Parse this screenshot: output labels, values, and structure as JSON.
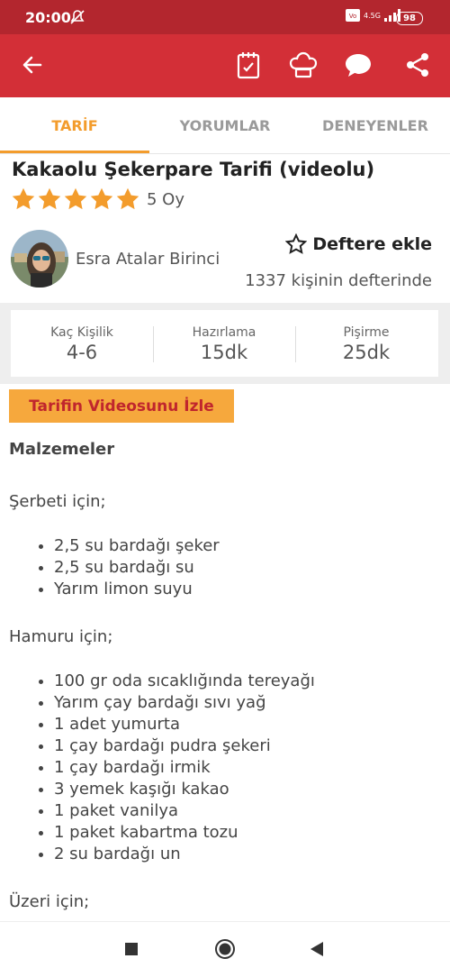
{
  "status": {
    "time": "20:00",
    "battery": "98",
    "network": "4.5G"
  },
  "tabs": [
    {
      "label": "TARİF"
    },
    {
      "label": "YORUMLAR"
    },
    {
      "label": "DENEYENLER"
    }
  ],
  "recipe": {
    "title": "Kakaolu Şekerpare Tarifi (videolu)",
    "rating": 5,
    "votes": "5 Oy",
    "author": "Esra Atalar Birinci",
    "favorite_label": "Deftere ekle",
    "favorite_count": "1337 kişinin defterinde"
  },
  "info": [
    {
      "label": "Kaç Kişilik",
      "value": "4-6"
    },
    {
      "label": "Hazırlama",
      "value": "15dk"
    },
    {
      "label": "Pişirme",
      "value": "25dk"
    }
  ],
  "video_button": "Tarifin Videosunu İzle",
  "ingredients": {
    "heading": "Malzemeler",
    "sections": [
      {
        "title": "Şerbeti için;",
        "items": [
          "2,5 su bardağı şeker",
          "2,5 su bardağı su",
          "Yarım limon suyu"
        ]
      },
      {
        "title": "Hamuru için;",
        "items": [
          "100 gr oda sıcaklığında tereyağı",
          "Yarım çay bardağı sıvı yağ",
          "1 adet yumurta",
          "1 çay bardağı pudra şekeri",
          "1 çay bardağı irmik",
          "3 yemek kaşığı kakao",
          "1 paket vanilya",
          "1 paket kabartma tozu",
          "2 su bardağı un"
        ]
      },
      {
        "title": "Üzeri için;",
        "items": []
      }
    ]
  },
  "colors": {
    "appbar": "#d32f37",
    "accent": "#f39c2c",
    "star": "#f39c2c",
    "video_bg": "#f6a83d"
  },
  "icons": [
    "back-arrow-icon",
    "checklist-icon",
    "chef-hat-icon",
    "chat-bubble-icon",
    "share-icon",
    "star-icon",
    "star-outline-icon"
  ]
}
